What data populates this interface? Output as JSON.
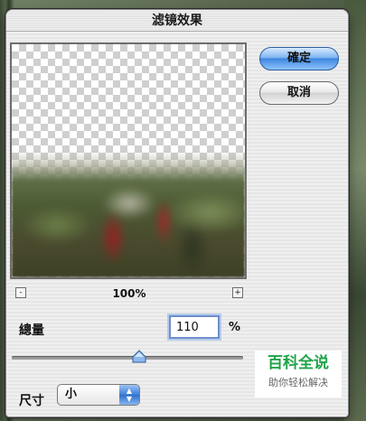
{
  "dialog": {
    "title": "滤镜效果"
  },
  "buttons": {
    "ok_label": "確定",
    "cancel_label": "取消"
  },
  "preview": {
    "zoom_minus_icon": "minus-icon",
    "zoom_plus_icon": "plus-icon",
    "zoom_minus": "-",
    "zoom_plus": "+",
    "zoom_level": "100%"
  },
  "amount": {
    "label": "總量",
    "value": "110",
    "unit": "%",
    "slider_fraction": 0.55
  },
  "size": {
    "label": "尺寸",
    "selected": "小",
    "arrows_icon": "up-down-arrows-icon",
    "arrow_up": "▲",
    "arrow_down": "▼"
  },
  "watermark": {
    "title": "百科全说",
    "subtitle": "助你轻松解决"
  },
  "colors": {
    "accent": "#3f86e1",
    "watermark_green": "#1fa34a"
  }
}
